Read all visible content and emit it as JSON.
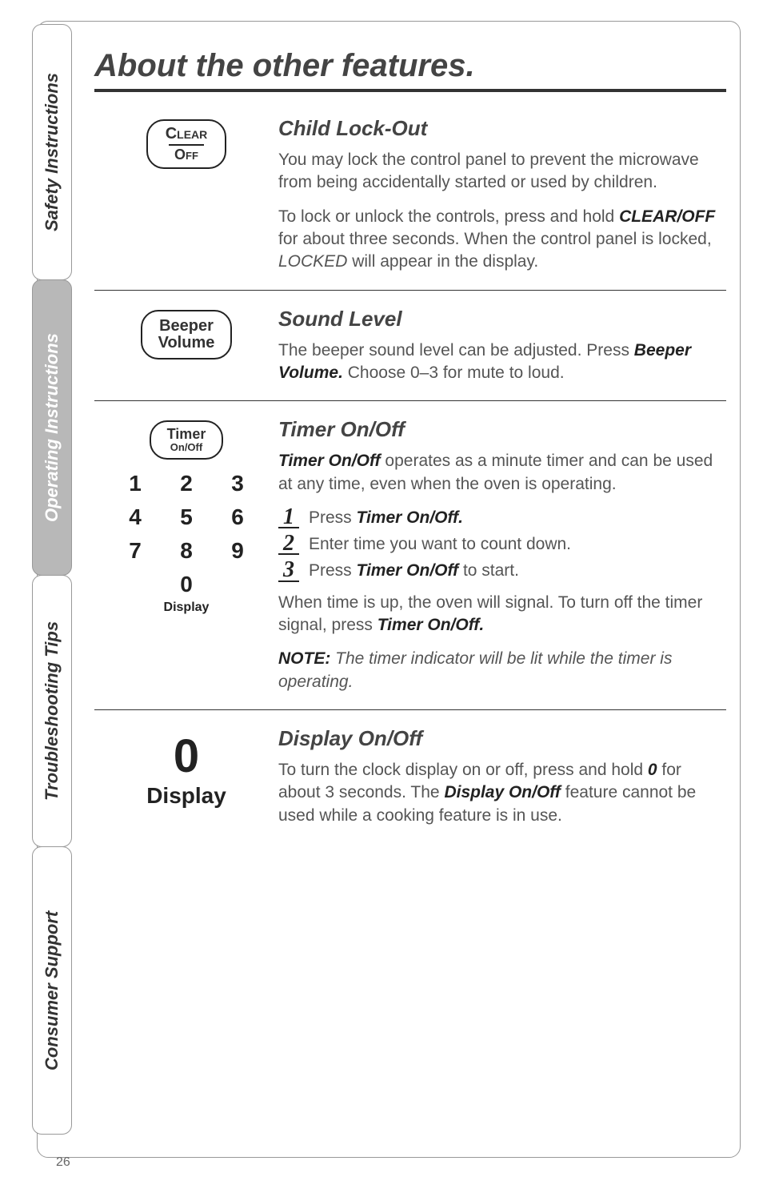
{
  "page_number": "26",
  "tabs": {
    "safety": "Safety Instructions",
    "operating": "Operating Instructions",
    "troubleshooting": "Troubleshooting Tips",
    "consumer": "Consumer Support"
  },
  "title": "About the other features.",
  "sections": {
    "childlock": {
      "btn_top": "Clear",
      "btn_bot": "Off",
      "heading": "Child Lock-Out",
      "p1_a": "You may lock the control panel to prevent the microwave from being accidentally started or used by children.",
      "p2_a": "To lock or unlock the controls, press and hold ",
      "p2_b": "CLEAR/OFF",
      "p2_c": " for about three seconds. When the control panel is locked, ",
      "p2_d": "LOCKED",
      "p2_e": " will appear in the display."
    },
    "sound": {
      "btn_top": "Beeper",
      "btn_bot": "Volume",
      "heading": "Sound Level",
      "p1_a": "The beeper sound level can be adjusted. Press ",
      "p1_b": "Beeper Volume.",
      "p1_c": " Choose 0–3 for mute to loud."
    },
    "timer": {
      "btn_top": "Timer",
      "btn_bot": "On/Off",
      "key1": "1",
      "key2": "2",
      "key3": "3",
      "key4": "4",
      "key5": "5",
      "key6": "6",
      "key7": "7",
      "key8": "8",
      "key9": "9",
      "key0": "0",
      "disp": "Display",
      "heading": "Timer On/Off",
      "p1_a": "Timer On/Off",
      "p1_b": " operates as a minute timer and can be used at any time, even when the oven is operating.",
      "step1_n": "1",
      "step1_a": "Press ",
      "step1_b": "Timer On/Off.",
      "step2_n": "2",
      "step2_a": "Enter time you want to count down.",
      "step3_n": "3",
      "step3_a": "Press ",
      "step3_b": "Timer On/Off",
      "step3_c": " to start.",
      "p2_a": "When time is up, the oven will signal. To turn off the timer signal, press ",
      "p2_b": "Timer On/Off.",
      "note_a": "NOTE:",
      "note_b": " The timer indicator will be lit while the timer is operating."
    },
    "display": {
      "big0": "0",
      "disp": "Display",
      "heading": "Display On/Off",
      "p1_a": "To turn the clock display on or off, press and hold ",
      "p1_b": "0",
      "p1_c": " for about 3 seconds. The ",
      "p1_d": "Display On/Off",
      "p1_e": " feature cannot be used while a cooking feature is in use."
    }
  }
}
